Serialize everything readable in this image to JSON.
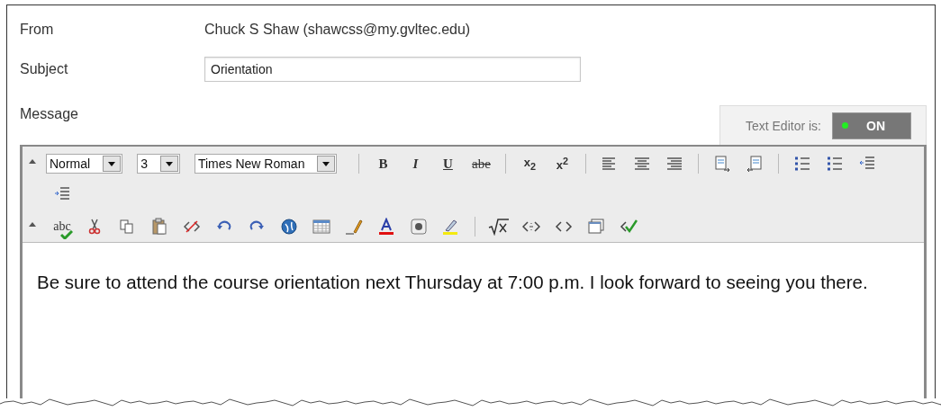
{
  "from": {
    "label": "From",
    "value": "Chuck S Shaw (shawcss@my.gvltec.edu)"
  },
  "subject": {
    "label": "Subject",
    "value": "Orientation"
  },
  "message": {
    "label": "Message"
  },
  "editor_toggle": {
    "label": "Text Editor is:",
    "state": "ON",
    "on": true
  },
  "toolbar": {
    "rows": [
      {
        "items": [
          {
            "kind": "select",
            "value": "Normal"
          },
          {
            "kind": "select",
            "value": "3"
          },
          {
            "kind": "select",
            "value": "Times New Roman"
          },
          {
            "kind": "separator"
          },
          {
            "kind": "bold",
            "label": "B"
          },
          {
            "kind": "italic",
            "label": "I"
          },
          {
            "kind": "underline",
            "label": "U"
          },
          {
            "kind": "strike",
            "label": "abe"
          },
          {
            "kind": "separator"
          },
          {
            "kind": "subscript",
            "label": "x$_{2}$"
          },
          {
            "kind": "superscript",
            "label": "x$^{2}$"
          },
          {
            "kind": "separator"
          },
          {
            "kind": "align-left"
          },
          {
            "kind": "align-center"
          },
          {
            "kind": "align-right"
          },
          {
            "kind": "separator"
          },
          {
            "kind": "indent-doc"
          },
          {
            "kind": "outdent-doc"
          },
          {
            "kind": "separator"
          },
          {
            "kind": "numbered-list"
          },
          {
            "kind": "bullet-list"
          },
          {
            "kind": "outdent"
          },
          {
            "kind": "indent"
          }
        ]
      },
      {
        "items": [
          {
            "kind": "spellcheck",
            "label": "abc"
          },
          {
            "kind": "cut"
          },
          {
            "kind": "copy"
          },
          {
            "kind": "paste"
          },
          {
            "kind": "unlink"
          },
          {
            "kind": "undo"
          },
          {
            "kind": "redo"
          },
          {
            "kind": "globe"
          },
          {
            "kind": "table"
          },
          {
            "kind": "pencil"
          },
          {
            "kind": "font-color"
          },
          {
            "kind": "media"
          },
          {
            "kind": "highlight"
          },
          {
            "kind": "separator"
          },
          {
            "kind": "math"
          },
          {
            "kind": "code-expand"
          },
          {
            "kind": "code"
          },
          {
            "kind": "window"
          },
          {
            "kind": "check-code"
          }
        ]
      }
    ]
  },
  "body": {
    "text": "Be sure to attend the course orientation next Thursday at 7:00 p.m. I look forward to seeing you there."
  }
}
